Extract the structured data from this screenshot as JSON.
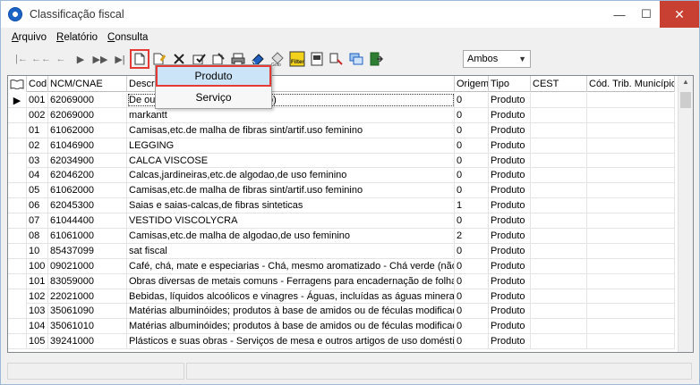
{
  "window": {
    "title": "Classificação fiscal"
  },
  "menu": [
    {
      "label": "Arquivo",
      "u": "A",
      "rest": "rquivo"
    },
    {
      "label": "Relatório",
      "u": "R",
      "rest": "elatório"
    },
    {
      "label": "Consulta",
      "u": "C",
      "rest": "onsulta"
    }
  ],
  "toolbar": {
    "icons": [
      "first-icon",
      "prior-icon",
      "rewind-icon",
      "play-icon",
      "fast-forward-icon",
      "last-icon",
      "new-document-icon",
      "edit-icon",
      "delete-icon",
      "apply-icon",
      "cancel-icon",
      "print-icon",
      "eraser-icon",
      "goto-icon",
      "filter-icon",
      "report-icon",
      "export-icon",
      "windows-icon",
      "exit-icon"
    ],
    "filter_label": "Ambos"
  },
  "dropdown": {
    "items": [
      "Produto",
      "Serviço"
    ]
  },
  "grid": {
    "columns": [
      "Cod",
      "NCM/CNAE",
      "Descri",
      "Origem",
      "Tipo",
      "CEST",
      "Cód. Trib. Município"
    ],
    "rows": [
      [
        "001",
        "62069000",
        "De ou",
        "cao)",
        "0",
        "Produto"
      ],
      [
        "002",
        "62069000",
        "markantt",
        "",
        "0",
        "Produto"
      ],
      [
        "01",
        "61062000",
        "Camisas,etc.de malha de fibras sint/artif.uso feminino",
        "",
        "0",
        "Produto"
      ],
      [
        "02",
        "61046900",
        "LEGGING",
        "",
        "0",
        "Produto"
      ],
      [
        "03",
        "62034900",
        "CALCA VISCOSE",
        "",
        "0",
        "Produto"
      ],
      [
        "04",
        "62046200",
        "Calcas,jardineiras,etc.de algodao,de uso feminino",
        "",
        "0",
        "Produto"
      ],
      [
        "05",
        "61062000",
        "Camisas,etc.de malha de fibras sint/artif.uso feminino",
        "",
        "0",
        "Produto"
      ],
      [
        "06",
        "62045300",
        "Saias e saias-calcas,de fibras sinteticas",
        "",
        "1",
        "Produto"
      ],
      [
        "07",
        "61044400",
        "VESTIDO VISCOLYCRA",
        "",
        "0",
        "Produto"
      ],
      [
        "08",
        "61061000",
        "Camisas,etc.de malha de algodao,de uso feminino",
        "",
        "2",
        "Produto"
      ],
      [
        "10",
        "85437099",
        "sat fiscal",
        "",
        "0",
        "Produto"
      ],
      [
        "100",
        "09021000",
        "Café, chá, mate e especiarias - Chá, mesmo aromatizado - Chá verde (não",
        "",
        "0",
        "Produto"
      ],
      [
        "101",
        "83059000",
        "Obras diversas de metais comuns - Ferragens para encadernação de folhas",
        "",
        "0",
        "Produto"
      ],
      [
        "102",
        "22021000",
        "Bebidas, líquidos alcoólicos e vinagres - Águas, incluídas as águas minerais e",
        "",
        "0",
        "Produto"
      ],
      [
        "103",
        "35061090",
        "Matérias albuminóides; produtos à base de amidos ou de féculas modificado",
        "",
        "0",
        "Produto"
      ],
      [
        "104",
        "35061010",
        "Matérias albuminóides; produtos à base de amidos ou de féculas modificado",
        "",
        "0",
        "Produto"
      ],
      [
        "105",
        "39241000",
        "Plásticos e suas obras - Serviços de mesa e outros artigos de uso doméstico",
        "",
        "0",
        "Produto"
      ]
    ]
  }
}
